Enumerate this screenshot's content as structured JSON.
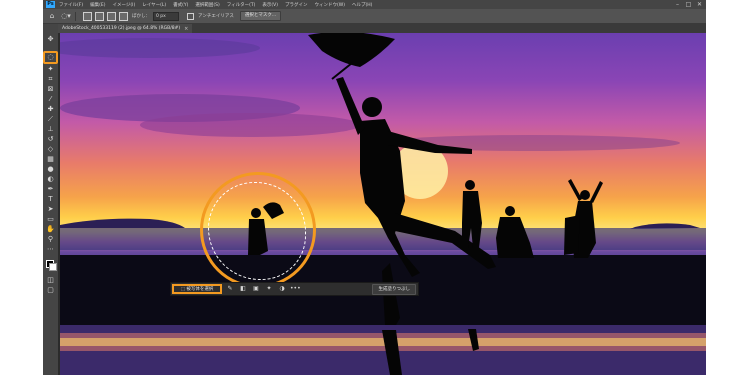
{
  "menubar": {
    "logo": "Ps",
    "items": [
      "ファイル(F)",
      "編集(E)",
      "イメージ(I)",
      "レイヤー(L)",
      "書式(Y)",
      "選択範囲(S)",
      "フィルター(T)",
      "表示(V)",
      "プラグイン",
      "ウィンドウ(W)",
      "ヘルプ(H)"
    ],
    "window_controls": [
      "–",
      "□",
      "✕"
    ]
  },
  "options": {
    "feather_label": "ぼかし：",
    "feather_value": "0 px",
    "antialias_label": "アンチエイリアス",
    "select_mask_button": "選択とマスク..."
  },
  "document": {
    "tab_title": "AdobeStock_400533119 (2).jpeg @ 64.8% (RGB/8#)",
    "close": "×"
  },
  "taskbar": {
    "select_subject_label": "⬚ 被写体を選択",
    "fill_button": "生成塗りつぶし",
    "more_icon": "•••"
  },
  "colors": {
    "accent": "#f39a21",
    "panel": "#454545",
    "options_bg": "#535353"
  },
  "icons": {
    "toolbar": [
      "move-icon",
      "lasso-icon",
      "magic-wand-icon",
      "crop-icon",
      "frame-icon",
      "eyedropper-icon",
      "healing-icon",
      "brush-icon",
      "stamp-icon",
      "history-brush-icon",
      "eraser-icon",
      "gradient-icon",
      "blur-icon",
      "dodge-icon",
      "pen-icon",
      "type-icon",
      "path-select-icon",
      "shape-icon",
      "hand-icon",
      "zoom-icon",
      "more-icon"
    ]
  }
}
